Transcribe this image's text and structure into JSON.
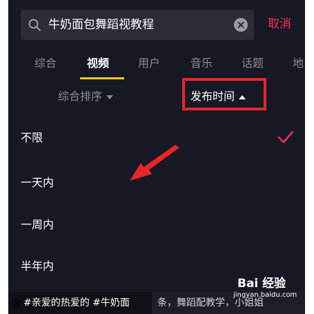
{
  "search": {
    "query": "牛奶面包舞蹈视教程"
  },
  "header": {
    "cancel_label": "取消"
  },
  "tabs": [
    {
      "label": "综合"
    },
    {
      "label": "视频"
    },
    {
      "label": "用户"
    },
    {
      "label": "音乐"
    },
    {
      "label": "话题"
    },
    {
      "label": "地"
    }
  ],
  "filters": {
    "sort_label": "综合排序",
    "time_label": "发布时间"
  },
  "time_options": [
    {
      "label": "不限",
      "selected": true
    },
    {
      "label": "一天内",
      "selected": false
    },
    {
      "label": "一周内",
      "selected": false
    },
    {
      "label": "半年内",
      "selected": false
    }
  ],
  "bottom": {
    "left_text": "#亲爱的热爱的 #牛奶面",
    "right_text": "条，舞蹈配教学，小姐姐"
  },
  "watermark": {
    "brand": "Bai 经验",
    "url": "jingyan.baidu.com"
  },
  "colors": {
    "background": "#161823",
    "accent_red": "#fe2c55",
    "tab_indicator": "#facc15",
    "highlight_box": "#e8252a",
    "annotation_arrow": "#e8252a"
  }
}
